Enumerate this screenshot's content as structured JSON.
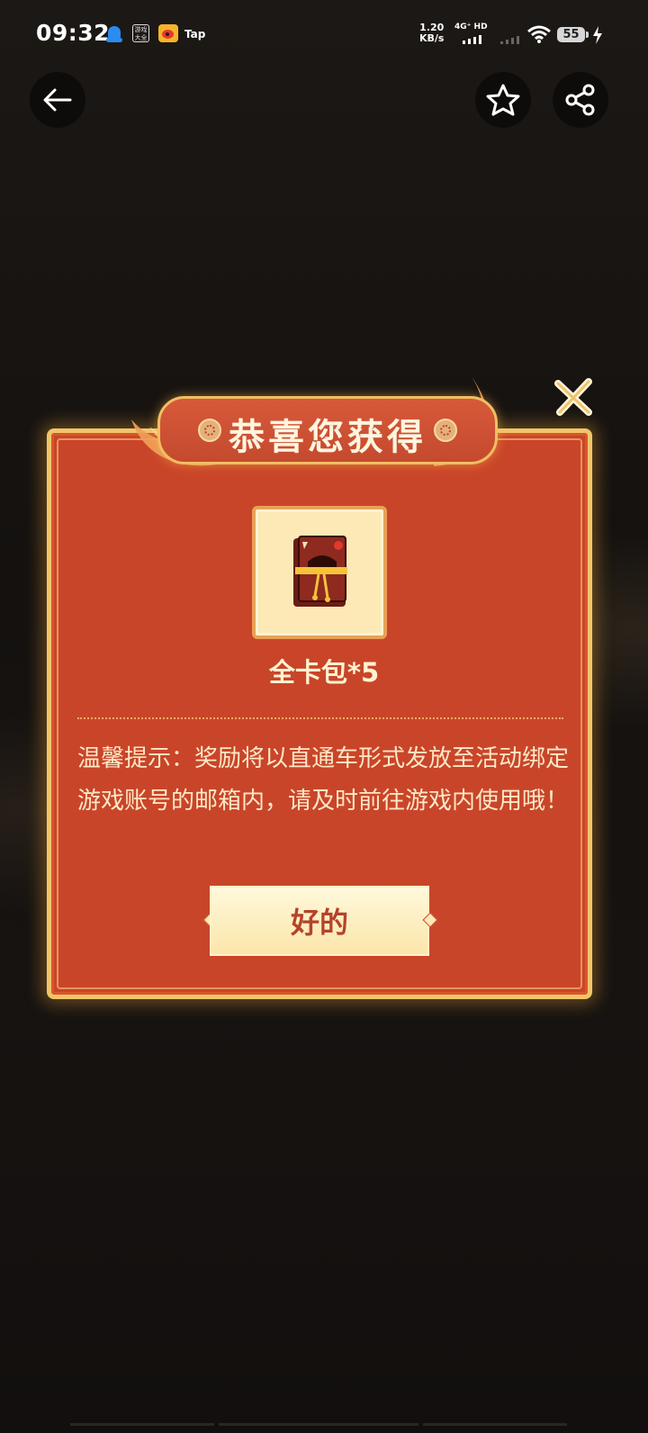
{
  "status_bar": {
    "time": "09:32",
    "app_icons": [
      "qq-icon",
      "game-center-icon",
      "weibo-icon",
      "taptap-icon"
    ],
    "game_center_label_1": "游戏",
    "game_center_label_2": "大全",
    "tap_label": "Tap",
    "net_speed_value": "1.20",
    "net_speed_unit": "KB/s",
    "network_label": "4G⁺ HD",
    "battery": "55"
  },
  "nav": {
    "back": "back-arrow-icon",
    "favorite": "star-icon",
    "share": "share-icon"
  },
  "dialog": {
    "title": "恭喜您获得",
    "item_name": "全卡包*5",
    "tip": "温馨提示：奖励将以直通车形式发放至活动绑定游戏账号的邮箱内，请及时前往游戏内使用哦！",
    "confirm_label": "好的"
  },
  "colors": {
    "dialog_red": "#c94529",
    "gold_border": "#f2c56a",
    "button_text": "#b5432a",
    "item_bg": "#fde9b5"
  }
}
